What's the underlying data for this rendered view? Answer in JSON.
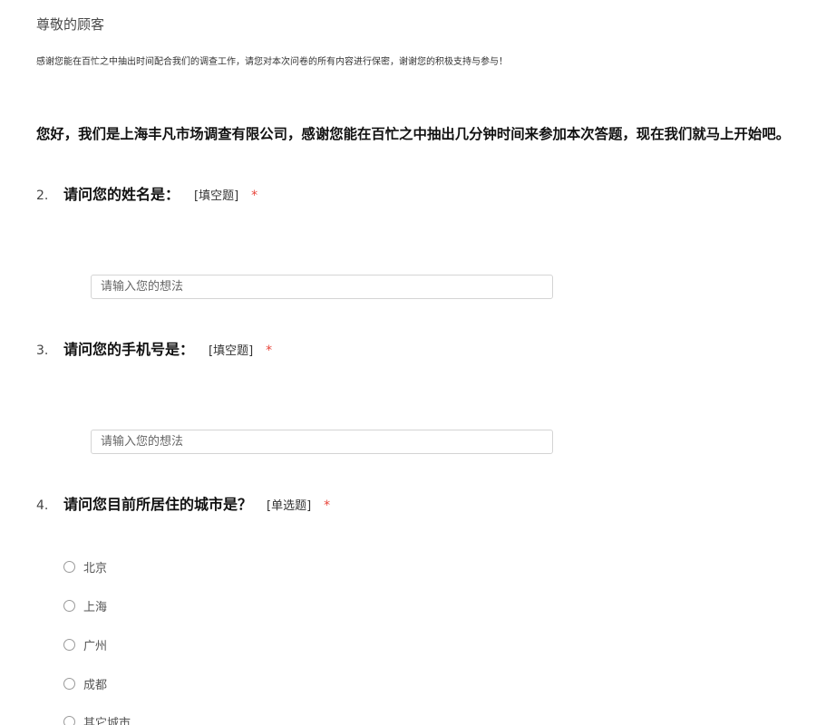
{
  "header": {
    "greeting": "尊敬的顾客",
    "notice": "感谢您能在百忙之中抽出时间配合我们的调查工作，请您对本次问卷的所有内容进行保密，谢谢您的积极支持与参与！"
  },
  "intro": "您好，我们是上海丰凡市场调查有限公司，感谢您能在百忙之中抽出几分钟时间来参加本次答题，现在我们就马上开始吧。",
  "questions": [
    {
      "number": "2.",
      "title": "请问您的姓名是：",
      "type": "[填空题]",
      "required": "*",
      "placeholder": "请输入您的想法",
      "value": ""
    },
    {
      "number": "3.",
      "title": "请问您的手机号是：",
      "type": "[填空题]",
      "required": "*",
      "placeholder": "请输入您的想法",
      "value": ""
    },
    {
      "number": "4.",
      "title": "请问您目前所居住的城市是？",
      "type": "[单选题]",
      "required": "*",
      "options": [
        "北京",
        "上海",
        "广州",
        "成都",
        "其它城市"
      ]
    }
  ],
  "colors": {
    "required_star": "#e8443a",
    "input_border": "#d4d4d4",
    "radio_border": "#9a9a9a"
  },
  "icons": {
    "radio": "radio-unchecked-icon"
  }
}
